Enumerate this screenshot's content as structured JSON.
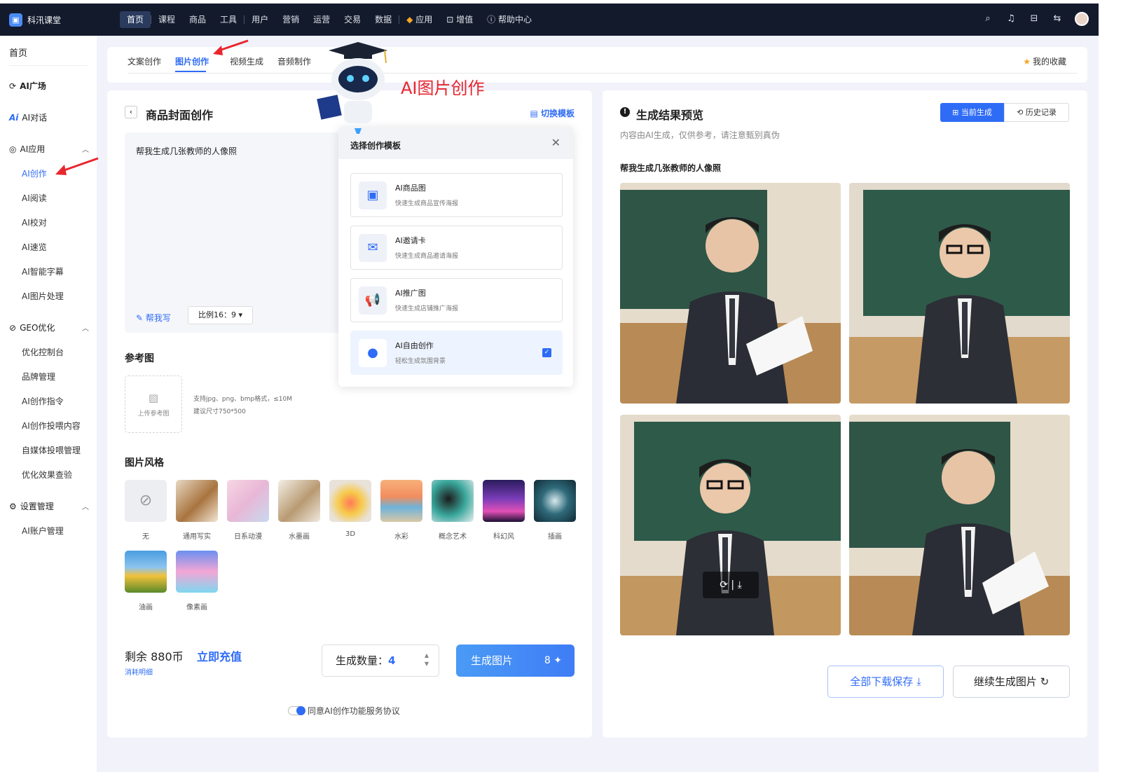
{
  "app": {
    "name": "科汛课堂"
  },
  "nav": [
    "首页",
    "课程",
    "商品",
    "工具",
    "用户",
    "营销",
    "运营",
    "交易",
    "数据",
    "应用",
    "增值",
    "帮助中心"
  ],
  "sidebar": {
    "home": "首页",
    "ai_square": "AI广场",
    "ai_chat": "AI对话",
    "ai_app": "AI应用",
    "ai_app_items": [
      "AI创作",
      "AI阅读",
      "AI校对",
      "AI速览",
      "AI智能字幕",
      "AI图片处理"
    ],
    "geo": "GEO优化",
    "geo_items": [
      "优化控制台",
      "品牌管理",
      "AI创作指令",
      "AI创作投喂内容",
      "自媒体投喂管理",
      "优化效果查验"
    ],
    "settings": "设置管理",
    "settings_items": [
      "AI账户管理"
    ]
  },
  "tabs": [
    "文案创作",
    "图片创作",
    "视频生成",
    "音频制作"
  ],
  "favorites": "我的收藏",
  "editor": {
    "title": "商品封面创作",
    "switch_template": "切换模板",
    "prompt": "帮我生成几张教师的人像照",
    "help_write": "帮我写",
    "ratio": "比例16：9",
    "ref_label": "参考图",
    "upload_label": "上传参考图",
    "upload_tip1": "支持jpg、png、bmp格式，≤10M",
    "upload_tip2": "建议尺寸750*500",
    "style_label": "图片风格",
    "styles": [
      "无",
      "通用写实",
      "日系动漫",
      "水墨画",
      "3D",
      "水彩",
      "概念艺术",
      "科幻风",
      "插画",
      "油画",
      "像素画"
    ],
    "remain": "剩余 880币",
    "recharge": "立即充值",
    "detail": "消耗明细",
    "qty_label": "生成数量：",
    "qty_value": "4",
    "generate": "生成图片",
    "cost": "8",
    "agree": "同意AI创作功能服务协议"
  },
  "popup": {
    "title": "选择创作模板",
    "templates": [
      {
        "name": "AI商品图",
        "desc": "快速生成商品宣传海报"
      },
      {
        "name": "AI邀请卡",
        "desc": "快速生成商品邀请海报"
      },
      {
        "name": "AI推广图",
        "desc": "快速生成店铺推广海报"
      },
      {
        "name": "AI自由创作",
        "desc": "轻松生成氛围背景"
      }
    ]
  },
  "annotation": "AI图片创作",
  "result": {
    "title": "生成结果预览",
    "current": "当前生成",
    "history": "历史记录",
    "disclaimer": "内容由AI生成，仅供参考，请注意甄别真伪",
    "prompt": "帮我生成几张教师的人像照",
    "download_all": "全部下载保存",
    "continue": "继续生成图片"
  }
}
